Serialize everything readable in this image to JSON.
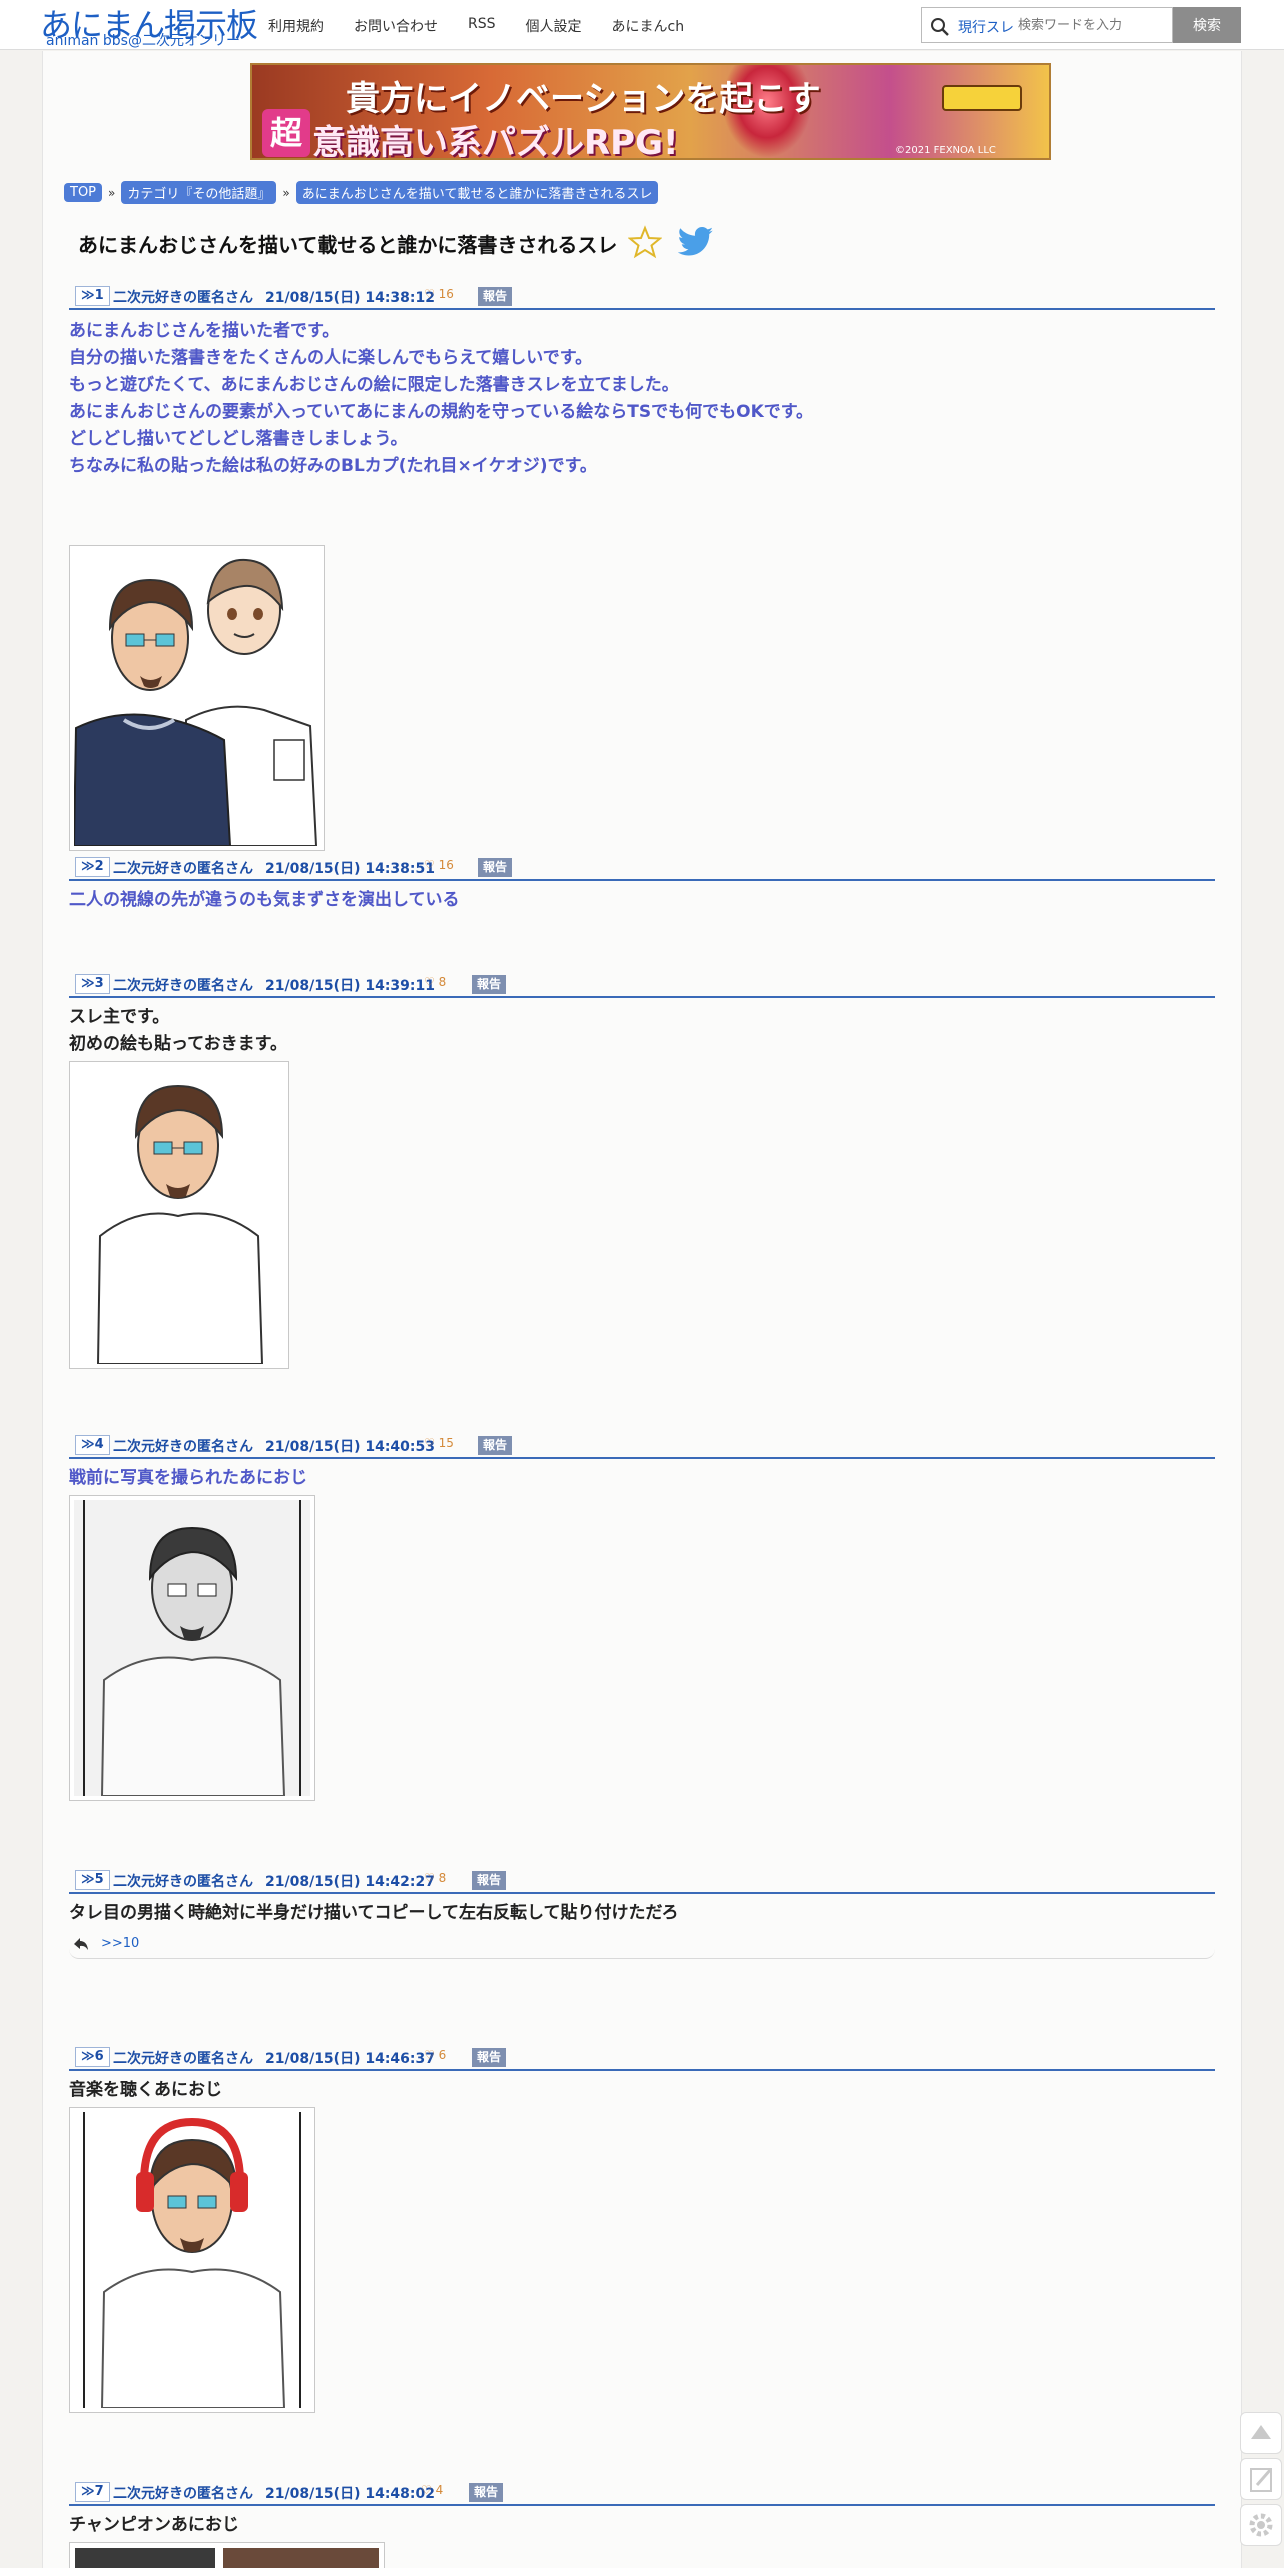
{
  "header": {
    "logo_main": "あにまん掲示板",
    "logo_sub": "animan bbs@二次元オンリー",
    "nav": [
      "利用規約",
      "お問い合わせ",
      "RSS",
      "個人設定",
      "あにまんch"
    ],
    "search_scope": "現行スレ",
    "search_placeholder": "検索ワードを入力",
    "search_button": "検索"
  },
  "banner": {
    "line1": "貴方にイノベーションを起こす",
    "kanji": "超",
    "line2": "意識高い系パズルRPG!",
    "copyright": "©2021 FEXNOA LLC"
  },
  "breadcrumb": [
    "TOP",
    "カテゴリ『その他話題』",
    "あにまんおじさんを描いて載せると誰かに落書きされるスレ"
  ],
  "breadcrumb_sep": "»",
  "thread": {
    "title": "あにまんおじさんを描いて載せると誰かに落書きされるスレ"
  },
  "report_label": "報告",
  "posts": [
    {
      "num": "≫1",
      "name": "二次元好きの匿名さん",
      "date": "21/08/15(日) 14:38:12",
      "likes": "16",
      "lines": [
        "あにまんおじさんを描いた者です。",
        "自分の描いた落書きをたくさんの人に楽しんでもらえて嬉しいです。",
        "もっと遊びたくて、あにまんおじさんの絵に限定した落書きスレを立てました。",
        "あにまんおじさんの要素が入っていてあにまんの規約を守っている絵ならTSでも何でもOKです。",
        "どしどし描いてどしどし落書きしましょう。",
        "ちなみに私の貼った絵は私の好みのBLカプ(たれ目×イケオジ)です。"
      ]
    },
    {
      "num": "≫2",
      "name": "二次元好きの匿名さん",
      "date": "21/08/15(日) 14:38:51",
      "likes": "16",
      "lines": [
        "二人の視線の先が違うのも気まずさを演出している"
      ]
    },
    {
      "num": "≫3",
      "name": "二次元好きの匿名さん",
      "date": "21/08/15(日) 14:39:11",
      "likes": "8",
      "lines": [
        "スレ主です。",
        "初めの絵も貼っておきます。"
      ]
    },
    {
      "num": "≫4",
      "name": "二次元好きの匿名さん",
      "date": "21/08/15(日) 14:40:53",
      "likes": "15",
      "lines": [
        "戦前に写真を撮られたあにおじ"
      ]
    },
    {
      "num": "≫5",
      "name": "二次元好きの匿名さん",
      "date": "21/08/15(日) 14:42:27",
      "likes": "8",
      "lines": [
        "タレ目の男描く時絶対に半身だけ描いてコピーして左右反転して貼り付けただろ"
      ],
      "reply_link": ">>10"
    },
    {
      "num": "≫6",
      "name": "二次元好きの匿名さん",
      "date": "21/08/15(日) 14:46:37",
      "likes": "6",
      "lines": [
        "音楽を聴くあにおじ"
      ]
    },
    {
      "num": "≫7",
      "name": "二次元好きの匿名さん",
      "date": "21/08/15(日) 14:48:02",
      "likes": "4",
      "lines": [
        "チャンピオンあにおじ"
      ]
    }
  ],
  "colors": {
    "link_blue": "#1d5fc4",
    "post_blue_text": "#5058c8",
    "crumb_bg": "#4d7bd6",
    "like_orange": "#d48a3a",
    "report_bg": "#7e8fb0"
  }
}
